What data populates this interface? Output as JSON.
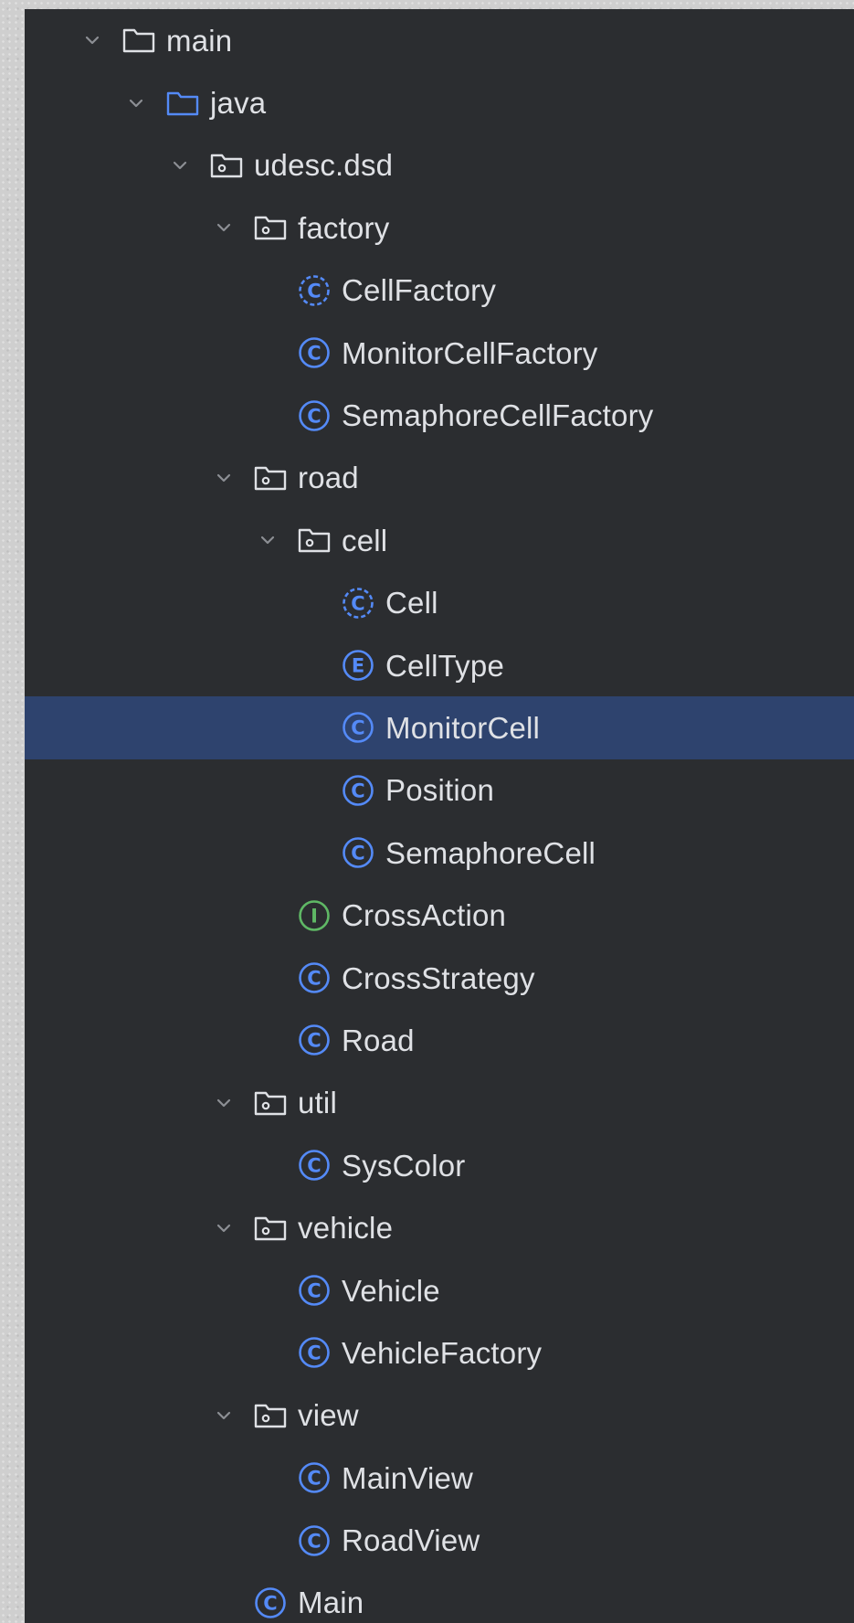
{
  "colors": {
    "panel_bg": "#2b2d30",
    "selected_bg": "#2e436e",
    "text": "#dfe1e5",
    "source_folder": "#548af7",
    "class_icon": "#548af7",
    "interface_icon": "#5fb865",
    "chevron": "#8c8f94"
  },
  "tree": {
    "items": [
      {
        "label": "main",
        "level": 0,
        "icon": "folder-icon",
        "expanded": true
      },
      {
        "label": "java",
        "level": 1,
        "icon": "source-folder-icon",
        "expanded": true
      },
      {
        "label": "udesc.dsd",
        "level": 2,
        "icon": "package-icon",
        "expanded": true
      },
      {
        "label": "factory",
        "level": 3,
        "icon": "package-icon",
        "expanded": true
      },
      {
        "label": "CellFactory",
        "level": 4,
        "icon": "abstract-class-icon"
      },
      {
        "label": "MonitorCellFactory",
        "level": 4,
        "icon": "class-icon"
      },
      {
        "label": "SemaphoreCellFactory",
        "level": 4,
        "icon": "class-icon"
      },
      {
        "label": "road",
        "level": 3,
        "icon": "package-icon",
        "expanded": true
      },
      {
        "label": "cell",
        "level": 4,
        "icon": "package-icon",
        "expanded": true
      },
      {
        "label": "Cell",
        "level": 5,
        "icon": "abstract-class-icon"
      },
      {
        "label": "CellType",
        "level": 5,
        "icon": "enum-icon"
      },
      {
        "label": "MonitorCell",
        "level": 5,
        "icon": "class-icon",
        "selected": true
      },
      {
        "label": "Position",
        "level": 5,
        "icon": "class-icon"
      },
      {
        "label": "SemaphoreCell",
        "level": 5,
        "icon": "class-icon"
      },
      {
        "label": "CrossAction",
        "level": 4,
        "icon": "interface-icon"
      },
      {
        "label": "CrossStrategy",
        "level": 4,
        "icon": "class-icon"
      },
      {
        "label": "Road",
        "level": 4,
        "icon": "class-icon"
      },
      {
        "label": "util",
        "level": 3,
        "icon": "package-icon",
        "expanded": true
      },
      {
        "label": "SysColor",
        "level": 4,
        "icon": "class-icon"
      },
      {
        "label": "vehicle",
        "level": 3,
        "icon": "package-icon",
        "expanded": true
      },
      {
        "label": "Vehicle",
        "level": 4,
        "icon": "class-icon"
      },
      {
        "label": "VehicleFactory",
        "level": 4,
        "icon": "class-icon"
      },
      {
        "label": "view",
        "level": 3,
        "icon": "package-icon",
        "expanded": true
      },
      {
        "label": "MainView",
        "level": 4,
        "icon": "class-icon"
      },
      {
        "label": "RoadView",
        "level": 4,
        "icon": "class-icon"
      },
      {
        "label": "Main",
        "level": 3,
        "icon": "class-icon"
      }
    ]
  }
}
